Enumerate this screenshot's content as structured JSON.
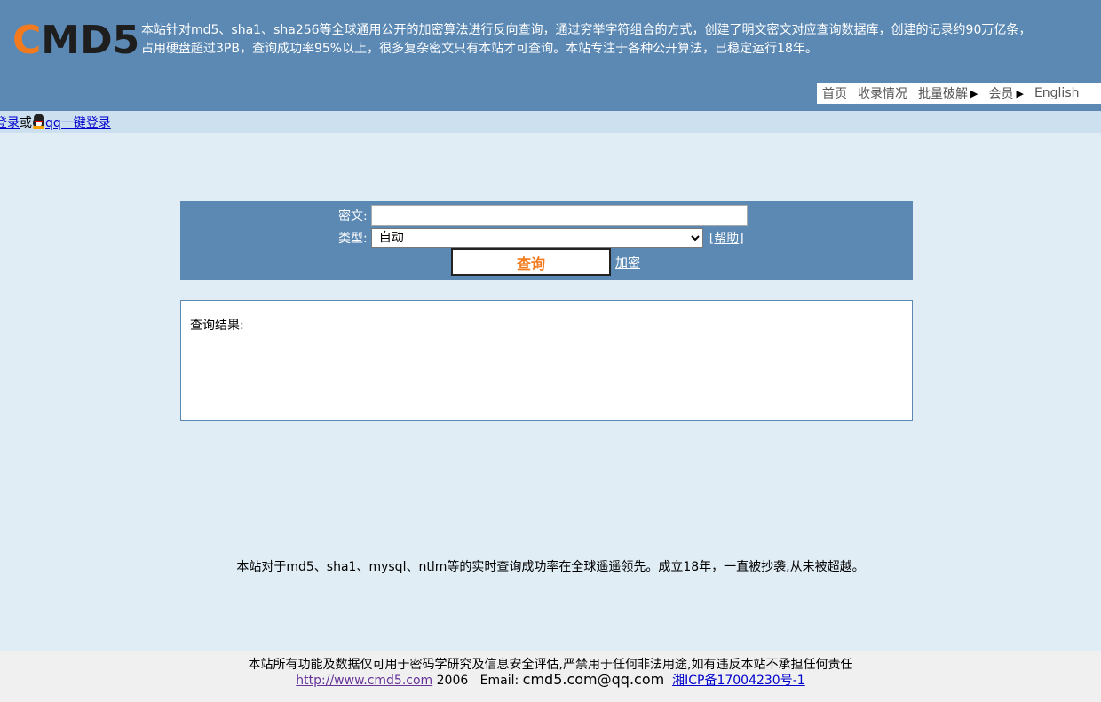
{
  "header": {
    "logo_c": "C",
    "logo_rest": "MD5",
    "intro_line1": "本站针对md5、sha1、sha256等全球通用公开的加密算法进行反向查询，通过穷举字符组合的方式，创建了明文密文对应查询数据库，创建的记录约90万亿条，",
    "intro_line2": "占用硬盘超过3PB，查询成功率95%以上，很多复杂密文只有本站才可查询。本站专注于各种公开算法，已稳定运行18年。",
    "nav": {
      "home": "首页",
      "records": "收录情况",
      "batch": "批量破解",
      "member": "会员",
      "english": "English"
    }
  },
  "login": {
    "login_text": "登录",
    "or_text": "或",
    "qq_text": "qq一键登录"
  },
  "search": {
    "cipher_label": "密文:",
    "cipher_value": "",
    "type_label": "类型:",
    "type_selected": "自动",
    "help_text": "帮助",
    "query_button": "查询",
    "encrypt_link": "加密"
  },
  "result": {
    "label": "查询结果:"
  },
  "tagline": "本站对于md5、sha1、mysql、ntlm等的实时查询成功率在全球遥遥领先。成立18年，一直被抄袭,从未被超越。",
  "footer": {
    "disclaimer": "本站所有功能及数据仅可用于密码学研究及信息安全评估,严禁用于任何非法用途,如有违反本站不承担任何责任",
    "site_url": "http://www.cmd5.com",
    "year": "2006",
    "email_label": "Email:",
    "email": "cmd5.com@qq.com",
    "icp": "湘ICP备17004230号-1"
  },
  "colors": {
    "header_bg": "#5b89b4",
    "logo_orange": "#f37b1d",
    "page_bg": "#e1edf5",
    "login_bar_bg": "#cde0f0"
  }
}
